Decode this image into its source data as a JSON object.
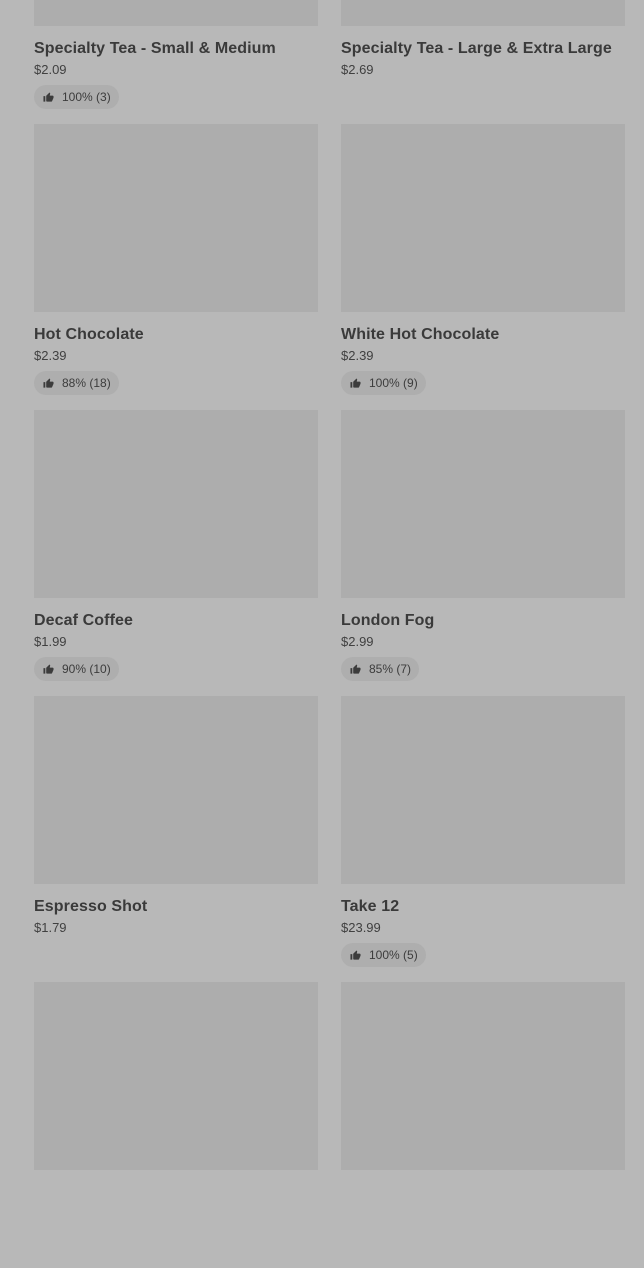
{
  "products": [
    {
      "name": "Specialty Tea - Small & Medium",
      "price": "$2.09",
      "rating": "100% (3)"
    },
    {
      "name": "Specialty Tea - Large & Extra Large",
      "price": "$2.69",
      "rating": ""
    },
    {
      "name": "Hot Chocolate",
      "price": "$2.39",
      "rating": "88% (18)"
    },
    {
      "name": "White Hot Chocolate",
      "price": "$2.39",
      "rating": "100% (9)"
    },
    {
      "name": "Decaf Coffee",
      "price": "$1.99",
      "rating": "90% (10)"
    },
    {
      "name": "London Fog",
      "price": "$2.99",
      "rating": "85% (7)"
    },
    {
      "name": "Espresso Shot",
      "price": "$1.79",
      "rating": ""
    },
    {
      "name": "Take 12",
      "price": "$23.99",
      "rating": "100% (5)"
    },
    {
      "name": "",
      "price": "",
      "rating": ""
    },
    {
      "name": "",
      "price": "",
      "rating": ""
    }
  ],
  "icons": {
    "rating": "thumbs-up-icon"
  }
}
